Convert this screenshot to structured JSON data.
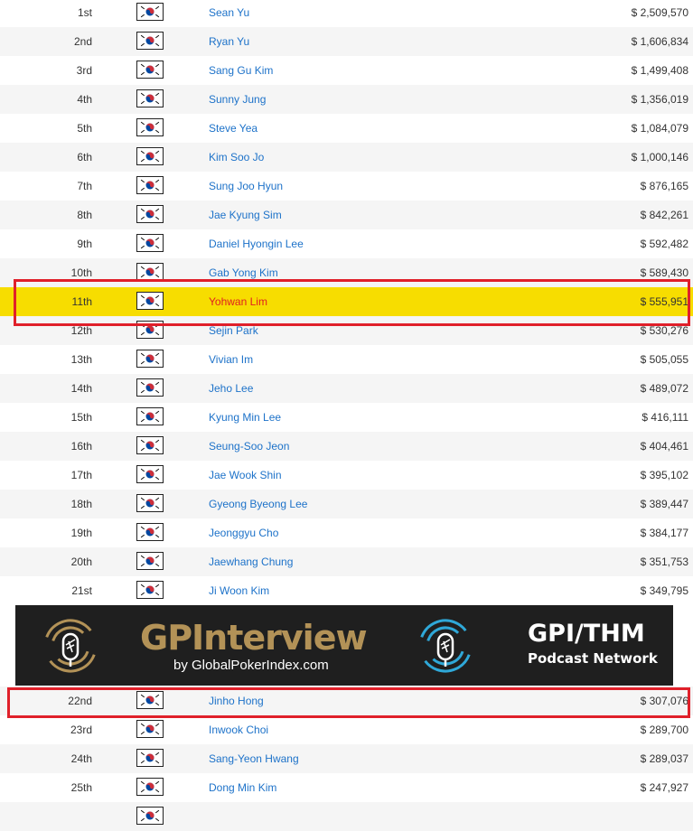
{
  "colors": {
    "link": "#1d72c9",
    "highlight_row": "#f7dd00",
    "highlight_text": "#e02020",
    "annotation_box": "#e0202a",
    "banner_bg": "#1f1f1f",
    "banner_gold": "#b39257",
    "banner_blue": "#2fa8d8"
  },
  "rows_top": [
    {
      "rank": "1st",
      "name": "Sean Yu",
      "winnings": "$ 2,509,570"
    },
    {
      "rank": "2nd",
      "name": "Ryan Yu",
      "winnings": "$ 1,606,834"
    },
    {
      "rank": "3rd",
      "name": "Sang Gu Kim",
      "winnings": "$ 1,499,408"
    },
    {
      "rank": "4th",
      "name": "Sunny Jung",
      "winnings": "$ 1,356,019"
    },
    {
      "rank": "5th",
      "name": "Steve Yea",
      "winnings": "$ 1,084,079"
    },
    {
      "rank": "6th",
      "name": "Kim Soo Jo",
      "winnings": "$ 1,000,146"
    },
    {
      "rank": "7th",
      "name": "Sung Joo Hyun",
      "winnings": "$ 876,165"
    },
    {
      "rank": "8th",
      "name": "Jae Kyung Sim",
      "winnings": "$ 842,261"
    },
    {
      "rank": "9th",
      "name": "Daniel Hyongin Lee",
      "winnings": "$ 592,482"
    },
    {
      "rank": "10th",
      "name": "Gab Yong Kim",
      "winnings": "$ 589,430"
    },
    {
      "rank": "11th",
      "name": "Yohwan Lim",
      "winnings": "$ 555,951",
      "highlight": true
    },
    {
      "rank": "12th",
      "name": "Sejin Park",
      "winnings": "$ 530,276"
    },
    {
      "rank": "13th",
      "name": "Vivian Im",
      "winnings": "$ 505,055"
    },
    {
      "rank": "14th",
      "name": "Jeho Lee",
      "winnings": "$ 489,072"
    },
    {
      "rank": "15th",
      "name": "Kyung Min Lee",
      "winnings": "$ 416,111"
    },
    {
      "rank": "16th",
      "name": "Seung-Soo Jeon",
      "winnings": "$ 404,461"
    },
    {
      "rank": "17th",
      "name": "Jae Wook Shin",
      "winnings": "$ 395,102"
    },
    {
      "rank": "18th",
      "name": "Gyeong Byeong Lee",
      "winnings": "$ 389,447"
    },
    {
      "rank": "19th",
      "name": "Jeonggyu Cho",
      "winnings": "$ 384,177"
    },
    {
      "rank": "20th",
      "name": "Jaewhang Chung",
      "winnings": "$ 351,753"
    },
    {
      "rank": "21st",
      "name": "Ji Woon Kim",
      "winnings": "$ 349,795"
    }
  ],
  "banner": {
    "left_title": "GPInterview",
    "left_subtitle": "by GlobalPokerIndex.com",
    "right_title": "GPI/THM",
    "right_subtitle": "Podcast Network",
    "left_icon": "microphone-icon",
    "right_icon": "microphone-icon"
  },
  "rows_bottom": [
    {
      "rank": "22nd",
      "name": "Jinho Hong",
      "winnings": "$ 307,076"
    },
    {
      "rank": "23rd",
      "name": "Inwook Choi",
      "winnings": "$ 289,700"
    },
    {
      "rank": "24th",
      "name": "Sang-Yeon Hwang",
      "winnings": "$ 289,037"
    },
    {
      "rank": "25th",
      "name": "Dong Min Kim",
      "winnings": "$ 247,927"
    },
    {
      "rank": "",
      "name": "",
      "winnings": ""
    }
  ]
}
